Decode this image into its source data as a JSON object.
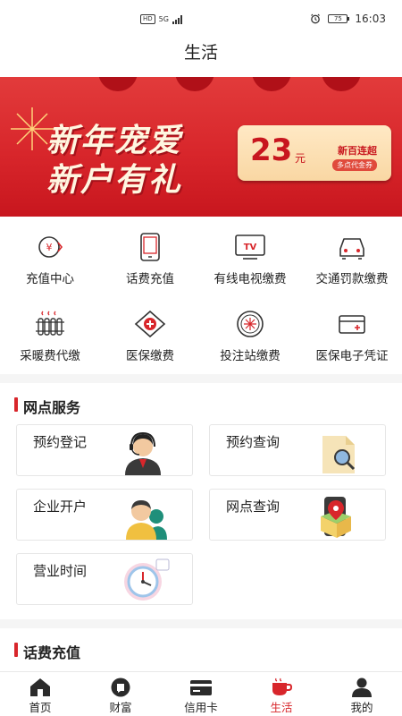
{
  "status_bar": {
    "network_badge": "HD",
    "network_type": "5G",
    "battery": "75",
    "time": "16:03"
  },
  "header": {
    "title": "生活"
  },
  "banner": {
    "line1": "新年宠爱",
    "line2": "新户有礼",
    "amount": "23",
    "unit": "元",
    "merchant": "新百连超",
    "voucher": "多点代金券"
  },
  "services": [
    {
      "label": "充值中心",
      "icon": "recharge-icon"
    },
    {
      "label": "话费充值",
      "icon": "phone-icon"
    },
    {
      "label": "有线电视缴费",
      "icon": "tv-icon"
    },
    {
      "label": "交通罚款缴费",
      "icon": "car-icon"
    },
    {
      "label": "采暖费代缴",
      "icon": "heater-icon"
    },
    {
      "label": "医保缴费",
      "icon": "medical-icon"
    },
    {
      "label": "投注站缴费",
      "icon": "lottery-icon"
    },
    {
      "label": "医保电子凭证",
      "icon": "medical-card-icon"
    }
  ],
  "outlet_section": {
    "title": "网点服务",
    "tiles": [
      {
        "label": "预约登记",
        "icon": "customer-service-icon"
      },
      {
        "label": "预约查询",
        "icon": "document-search-icon"
      },
      {
        "label": "企业开户",
        "icon": "business-person-icon"
      },
      {
        "label": "网点查询",
        "icon": "map-location-icon"
      },
      {
        "label": "营业时间",
        "icon": "clock-icon"
      }
    ]
  },
  "topup_section": {
    "title": "话费充值"
  },
  "tabbar": {
    "tabs": [
      {
        "label": "首页",
        "icon": "home-icon"
      },
      {
        "label": "财富",
        "icon": "wealth-icon"
      },
      {
        "label": "信用卡",
        "icon": "credit-card-icon"
      },
      {
        "label": "生活",
        "icon": "coffee-cup-icon"
      },
      {
        "label": "我的",
        "icon": "user-icon"
      }
    ],
    "active_index": 3
  },
  "colors": {
    "accent": "#d8262b",
    "text": "#222222",
    "background": "#f5f5f5"
  }
}
